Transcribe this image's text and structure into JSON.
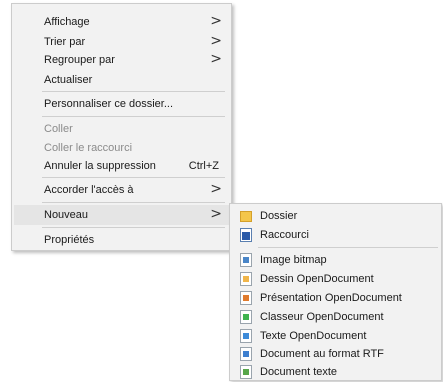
{
  "main_menu": {
    "items": [
      {
        "label": "Affichage",
        "has_submenu": true
      },
      {
        "label": "Trier par",
        "has_submenu": true
      },
      {
        "label": "Regrouper par",
        "has_submenu": true
      },
      {
        "label": "Actualiser"
      },
      {
        "label": "Personnaliser ce dossier..."
      },
      {
        "label": "Coller",
        "disabled": true
      },
      {
        "label": "Coller le raccourci",
        "disabled": true
      },
      {
        "label": "Annuler la suppression",
        "shortcut": "Ctrl+Z"
      },
      {
        "label": "Accorder l'accès à",
        "has_submenu": true
      },
      {
        "label": "Nouveau",
        "has_submenu": true,
        "highlighted": true
      },
      {
        "label": "Propriétés"
      }
    ],
    "submenu_arrow": ">"
  },
  "sub_menu": {
    "items": [
      {
        "label": "Dossier",
        "icon": "folder-icon"
      },
      {
        "label": "Raccourci",
        "icon": "shortcut-icon"
      },
      {
        "label": "Image bitmap",
        "icon": "bitmap-image-icon"
      },
      {
        "label": "Dessin OpenDocument",
        "icon": "opendocument-drawing-icon"
      },
      {
        "label": "Présentation OpenDocument",
        "icon": "opendocument-presentation-icon"
      },
      {
        "label": "Classeur OpenDocument",
        "icon": "opendocument-spreadsheet-icon"
      },
      {
        "label": "Texte OpenDocument",
        "icon": "opendocument-text-icon"
      },
      {
        "label": "Document au format RTF",
        "icon": "rtf-document-icon"
      },
      {
        "label": "Document texte",
        "icon": "text-document-icon"
      }
    ]
  }
}
